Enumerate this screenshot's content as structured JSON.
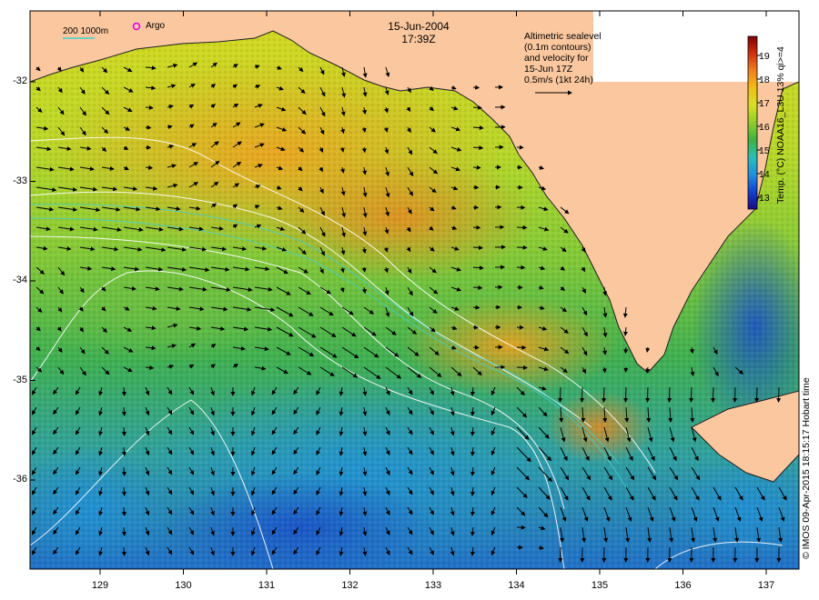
{
  "header": {
    "date": "15-Jun-2004",
    "time": "17:39Z"
  },
  "legend": {
    "isobaths": "200 1000m",
    "argo": "Argo",
    "argo_color": "#e000e0",
    "isobath_color": "#40d0d0"
  },
  "note": {
    "lines": [
      "Altimetric sealevel",
      "(0.1m contours)",
      "and velocity for",
      "15-Jun 17Z",
      "0.5m/s (1kt 24h)"
    ]
  },
  "colorbar": {
    "title": "Temp. (°C) NOAA16_L3U 13% qi>=4",
    "ticks": [
      "19",
      "18",
      "17",
      "16",
      "15",
      "14",
      "13"
    ],
    "colors": [
      "#1a0a8a",
      "#1040d0",
      "#1e90e0",
      "#28c0b8",
      "#40b040",
      "#90cc30",
      "#d8e020",
      "#f0c010",
      "#f08020",
      "#d03010",
      "#800000"
    ]
  },
  "axes": {
    "x_ticks": [
      "129",
      "130",
      "131",
      "132",
      "133",
      "134",
      "135",
      "136",
      "137"
    ],
    "y_ticks": [
      "-32",
      "-33",
      "-34",
      "-35",
      "-36"
    ]
  },
  "footer": {
    "credit": "© IMOS 09-Apr-2015 18:15:17 Hobart time"
  },
  "colors": {
    "land": "#fac79e",
    "land_outline": "#202020",
    "contour": "#ffffff"
  }
}
